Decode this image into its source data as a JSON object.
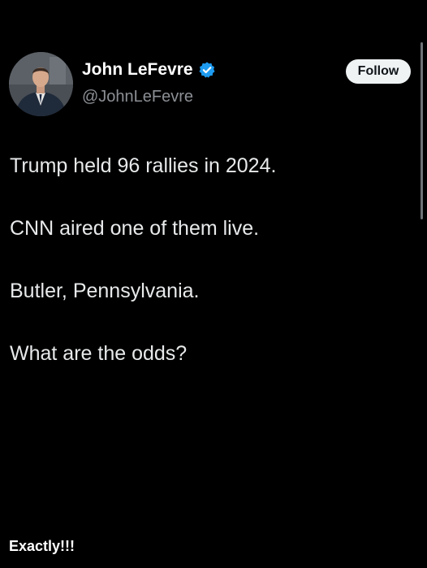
{
  "profile": {
    "display_name": "John LeFevre",
    "handle": "@JohnLeFevre",
    "verified": true,
    "verified_icon": "verified-badge-icon",
    "avatar_icon": "profile-photo"
  },
  "actions": {
    "follow_label": "Follow"
  },
  "tweet": {
    "lines": [
      "Trump held 96 rallies in 2024.",
      "CNN aired one of them live.",
      "Butler, Pennsylvania.",
      "What are the odds?"
    ]
  },
  "caption": {
    "text": "Exactly!!!"
  },
  "colors": {
    "background": "#000000",
    "text": "#e7e9ea",
    "handle": "#8b8f94",
    "verified_blue": "#1d9bf0",
    "follow_bg": "#eff3f4",
    "follow_text": "#0f1419"
  }
}
